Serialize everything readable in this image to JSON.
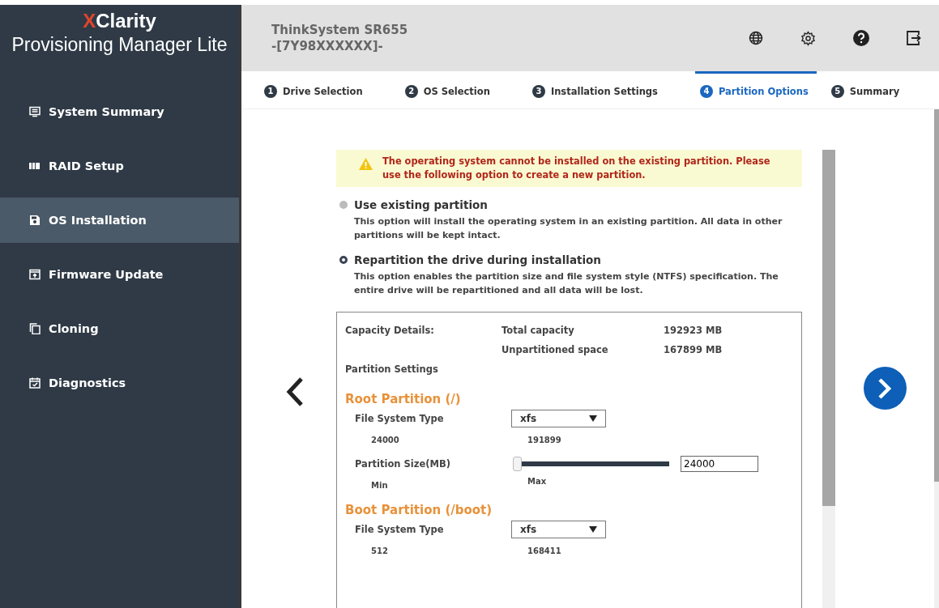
{
  "brand": {
    "accent": "X",
    "name": "Clarity",
    "product": "Provisioning Manager Lite"
  },
  "sidebar": {
    "items": [
      {
        "label": "System Summary",
        "selected": false
      },
      {
        "label": "RAID Setup",
        "selected": false
      },
      {
        "label": "OS Installation",
        "selected": true
      },
      {
        "label": "Firmware Update",
        "selected": false
      },
      {
        "label": "Cloning",
        "selected": false
      },
      {
        "label": "Diagnostics",
        "selected": false
      }
    ]
  },
  "header": {
    "title": "ThinkSystem SR655",
    "subtitle": "-[7Y98XXXXXX]-"
  },
  "steps": [
    {
      "number": "1",
      "label": "Drive Selection",
      "selected": false
    },
    {
      "number": "2",
      "label": "OS Selection",
      "selected": false
    },
    {
      "number": "3",
      "label": "Installation Settings",
      "selected": false
    },
    {
      "number": "4",
      "label": "Partition Options",
      "selected": true
    },
    {
      "number": "5",
      "label": "Summary",
      "selected": false
    }
  ],
  "notice": {
    "text": "The operating system cannot be installed on the existing partition. Please use the following option to create a new partition."
  },
  "options": [
    {
      "label": "Use existing partition",
      "description": "This option will install the operating system in an existing partition. All data in other partitions will be kept intact.",
      "selected": false
    },
    {
      "label": "Repartition the drive during installation",
      "description": "This option enables the partition size and file system style (NTFS) specification. The entire drive will be repartitioned and all data will be lost.",
      "selected": true
    }
  ],
  "capacity": {
    "label": "Capacity Details:",
    "rows": [
      {
        "name": "Total capacity",
        "value": "192923 MB"
      },
      {
        "name": "Unpartitioned space",
        "value": "167899 MB"
      }
    ]
  },
  "partition_settings": "Partition Settings",
  "partitions": [
    {
      "title": "Root Partition (/)",
      "fs_label": "File System Type",
      "fs_value": "xfs",
      "min_value": "24000",
      "max_value": "191899",
      "size_label": "Partition Size(MB)",
      "level": 0,
      "size_value": "24000",
      "min_label": "Min",
      "max_label": "Max"
    },
    {
      "title": "Boot Partition (/boot)",
      "fs_label": "File System Type",
      "fs_value": "xfs",
      "min_value": "512",
      "max_value": "168411"
    }
  ]
}
